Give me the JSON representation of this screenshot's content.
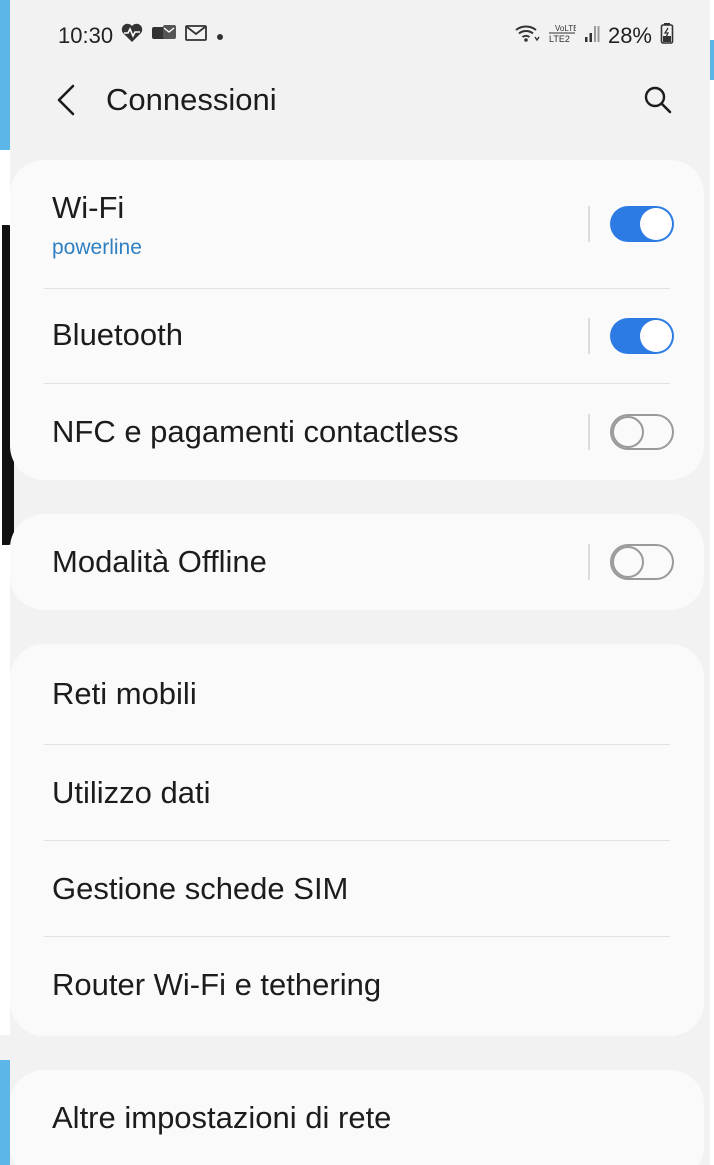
{
  "status_bar": {
    "time": "10:30",
    "notification_icons": [
      "heart-rate-icon",
      "message-icon",
      "gmail-icon",
      "dot-icon"
    ],
    "system_icons": [
      "wifi-icon",
      "volte-lte2-icon",
      "signal-icon"
    ],
    "volte_text": "VoLTE2",
    "battery": "28%"
  },
  "header": {
    "title": "Connessioni",
    "back_icon": "chevron-left-icon",
    "search_icon": "search-icon"
  },
  "groups": {
    "radio": {
      "wifi": {
        "label": "Wi-Fi",
        "subtitle": "powerline",
        "enabled": true
      },
      "bluetooth": {
        "label": "Bluetooth",
        "enabled": true
      },
      "nfc": {
        "label": "NFC e pagamenti contactless",
        "enabled": false
      }
    },
    "offline": {
      "airplane": {
        "label": "Modalità Offline",
        "enabled": false
      }
    },
    "network": {
      "mobile_networks": {
        "label": "Reti mobili"
      },
      "data_usage": {
        "label": "Utilizzo dati"
      },
      "sim_manager": {
        "label": "Gestione schede SIM"
      },
      "hotspot": {
        "label": "Router Wi-Fi e tethering"
      }
    },
    "more": {
      "more_settings": {
        "label": "Altre impostazioni di rete"
      }
    }
  },
  "colors": {
    "accent": "#2c7be5",
    "subtitle": "#2f7fc2",
    "background": "#f2f2f2",
    "card": "#fafafa"
  }
}
